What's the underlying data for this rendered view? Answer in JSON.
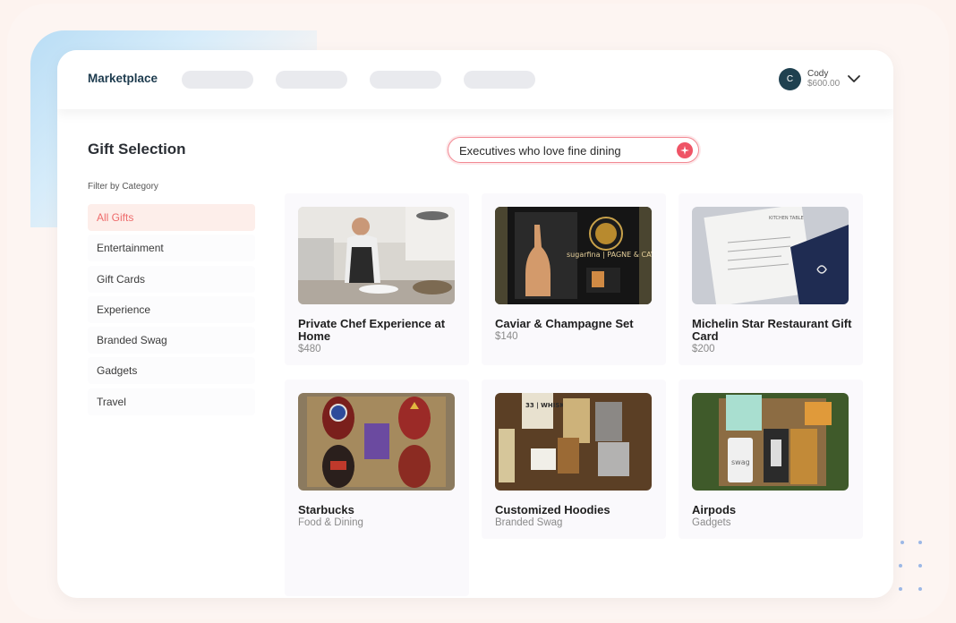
{
  "header": {
    "brand": "Marketplace",
    "user": {
      "initial": "C",
      "name": "Cody",
      "balance": "$600.00"
    }
  },
  "page_title": "Gift Selection",
  "search": {
    "value": "Executives who love fine dining"
  },
  "filter": {
    "label": "Filter by Category",
    "items": [
      {
        "label": "All Gifts",
        "active": true
      },
      {
        "label": "Entertainment"
      },
      {
        "label": "Gift Cards"
      },
      {
        "label": "Experience"
      },
      {
        "label": "Branded Swag"
      },
      {
        "label": "Gadgets"
      },
      {
        "label": "Travel"
      }
    ]
  },
  "gifts": [
    {
      "title": "Private Chef Experience at Home",
      "subtitle": "$480"
    },
    {
      "title": "Caviar & Champagne Set",
      "subtitle": "$140",
      "image_text": "sugarfina | PAGNE & CAVIAR"
    },
    {
      "title": "Michelin Star Restaurant Gift Card",
      "subtitle": "$200",
      "image_text": "KITCHEN TABLE"
    },
    {
      "title": "Starbucks",
      "subtitle": "Food & Dining"
    },
    {
      "title": "Customized Hoodies",
      "subtitle": "Branded Swag",
      "image_text": "33 | WHISKEY"
    },
    {
      "title": "Airpods",
      "subtitle": "Gadgets",
      "image_text": "swag"
    }
  ],
  "colors": {
    "accent": "#ef5466",
    "brand_text": "#1d3b4e",
    "active_category_bg": "#fdeeea",
    "active_category_text": "#ee6b6b"
  },
  "icons": [
    "chevron-down-icon",
    "sparkle-icon",
    "avatar"
  ]
}
